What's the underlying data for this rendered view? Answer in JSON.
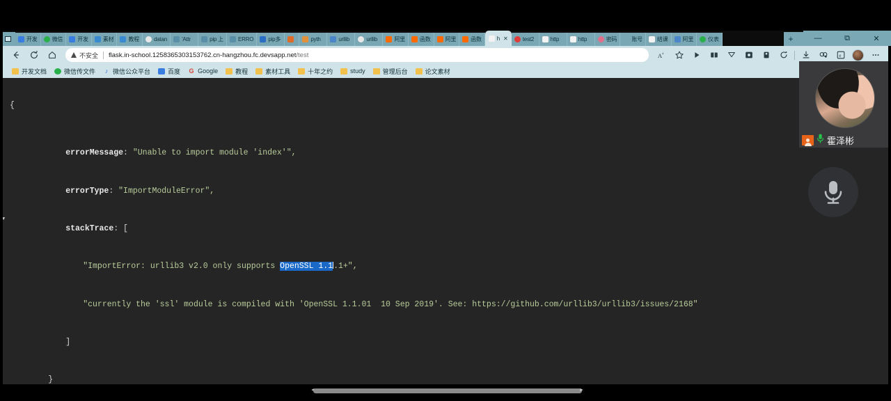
{
  "window": {
    "controls": {
      "minimize": "—",
      "maximize": "⧉",
      "close": "✕"
    },
    "new_tab_label": "+"
  },
  "tabs": [
    {
      "label": "开发",
      "favicon": "blue-doc-icon",
      "color": "#3a7de0",
      "active": false
    },
    {
      "label": "微信",
      "favicon": "wechat-icon",
      "color": "#2ab04a",
      "active": false
    },
    {
      "label": "开发",
      "favicon": "blue-doc-icon",
      "color": "#3a7de0",
      "active": false
    },
    {
      "label": "素材",
      "favicon": "blue-icon",
      "color": "#3a8ad0",
      "active": false
    },
    {
      "label": "教程",
      "favicon": "blue-icon",
      "color": "#3a8ad0",
      "active": false
    },
    {
      "label": "datan",
      "favicon": "globe-icon",
      "color": "#e8e8e8",
      "active": false
    },
    {
      "label": "'Attr",
      "favicon": "search-icon",
      "color": "#5a8fa8",
      "active": false
    },
    {
      "label": "pip 上",
      "favicon": "search-icon",
      "color": "#5a8fa8",
      "active": false
    },
    {
      "label": "ERRO",
      "favicon": "search-icon",
      "color": "#5a8fa8",
      "active": false
    },
    {
      "label": "pip多",
      "favicon": "blue-icon",
      "color": "#2b6fc4",
      "active": false
    },
    {
      "label": "",
      "favicon": "orange-icon",
      "color": "#e06c2a",
      "active": false
    },
    {
      "label": "pyth",
      "favicon": "orange-icon",
      "color": "#e0913a",
      "active": false
    },
    {
      "label": "urllib",
      "favicon": "search-icon",
      "color": "#4a86c8",
      "active": false
    },
    {
      "label": "urllib",
      "favicon": "globe-icon",
      "color": "#e8e8e8",
      "active": false
    },
    {
      "label": "阿里",
      "favicon": "aliyun-icon",
      "color": "#ff6a00",
      "active": false
    },
    {
      "label": "函数",
      "favicon": "aliyun-icon",
      "color": "#ff6a00",
      "active": false
    },
    {
      "label": "阿里",
      "favicon": "aliyun-icon",
      "color": "#ff6a00",
      "active": false
    },
    {
      "label": "函数",
      "favicon": "aliyun-icon",
      "color": "#ff6a00",
      "active": false
    },
    {
      "label": "h",
      "favicon": "page-icon",
      "color": "#f2f2f2",
      "active": true,
      "close": "✕"
    },
    {
      "label": "test2",
      "favicon": "red-icon",
      "color": "#e03a3a",
      "active": false
    },
    {
      "label": "http",
      "favicon": "page-icon",
      "color": "#f2f2f2",
      "active": false
    },
    {
      "label": "http",
      "favicon": "page-icon",
      "color": "#f2f2f2",
      "active": false
    },
    {
      "label": "密码",
      "favicon": "pink-icon",
      "color": "#e0708a",
      "active": false
    },
    {
      "label": "账号",
      "favicon": "none-icon",
      "color": "#9bb9c2",
      "active": false
    },
    {
      "label": "结课",
      "favicon": "page-icon",
      "color": "#f2f2f2",
      "active": false
    },
    {
      "label": "阿里",
      "favicon": "search-icon",
      "color": "#4a86c8",
      "active": false
    },
    {
      "label": "仪表",
      "favicon": "green-icon",
      "color": "#2ab04a",
      "active": false
    }
  ],
  "toolbar": {
    "back_icon": "back-arrow-icon",
    "reload_icon": "reload-icon",
    "home_icon": "home-icon",
    "security_label": "不安全",
    "url_host": "flask.in-school.1258365303153762.cn-hangzhou.fc.devsapp.net",
    "url_path": "/test",
    "read_aloud_icon": "read-aloud-icon",
    "favorite_icon": "star-icon",
    "right_icons": [
      "play-icon",
      "collections-icon",
      "split-screen-icon",
      "browser-essentials-icon",
      "extension-icon",
      "copilot-icon",
      "downloads-icon",
      "math-solver-icon",
      "edge-icon"
    ],
    "settings_icon": "ellipsis-icon"
  },
  "bookmarks": [
    {
      "label": "开发文档",
      "icon": "folder-icon"
    },
    {
      "label": "微信传文件",
      "icon": "wechat-icon"
    },
    {
      "label": "微信公众平台",
      "icon": "mp-icon"
    },
    {
      "label": "百度",
      "icon": "baidu-icon"
    },
    {
      "label": "Google",
      "icon": "google-icon"
    },
    {
      "label": "教程",
      "icon": "folder-icon"
    },
    {
      "label": "素材工具",
      "icon": "folder-icon"
    },
    {
      "label": "十年之约",
      "icon": "folder-icon"
    },
    {
      "label": "study",
      "icon": "folder-icon"
    },
    {
      "label": "管理后台",
      "icon": "folder-icon"
    },
    {
      "label": "论文素材",
      "icon": "folder-icon"
    }
  ],
  "json_viewer": {
    "open_brace": "{",
    "close_brace": "}",
    "error_message_key": "errorMessage",
    "error_message_value": "\"Unable to import module 'index'\",",
    "error_type_key": "errorType",
    "error_type_value": "\"ImportModuleError\",",
    "stack_trace_key": "stackTrace",
    "stack_trace_open": "[",
    "stack_trace_close": "]",
    "collapse_triangle": "▼",
    "trace_line1_pre": "\"ImportError: urllib3 v2.0 only supports ",
    "trace_line1_selected": "OpenSSL 1.1",
    "trace_line1_post": ".1+\",",
    "trace_line2": "\"currently the 'ssl' module is compiled with 'OpenSSL 1.1.01  10 Sep 2019'. See: https://github.com/urllib3/urllib3/issues/2168\"",
    "selection_color": "#1a69c9",
    "background_color": "#252526",
    "key_color": "#e8e8e8",
    "string_color": "#b9cc9a"
  },
  "meeting": {
    "participant_name": "霍泽彬",
    "host_icon": "host-badge-icon",
    "mic_icon": "microphone-icon",
    "avatar_icon": "participant-avatar",
    "mic_button_icon": "microphone-button-icon"
  },
  "scrollbar": {
    "left_arrow": "◄",
    "right_arrow": "►"
  }
}
